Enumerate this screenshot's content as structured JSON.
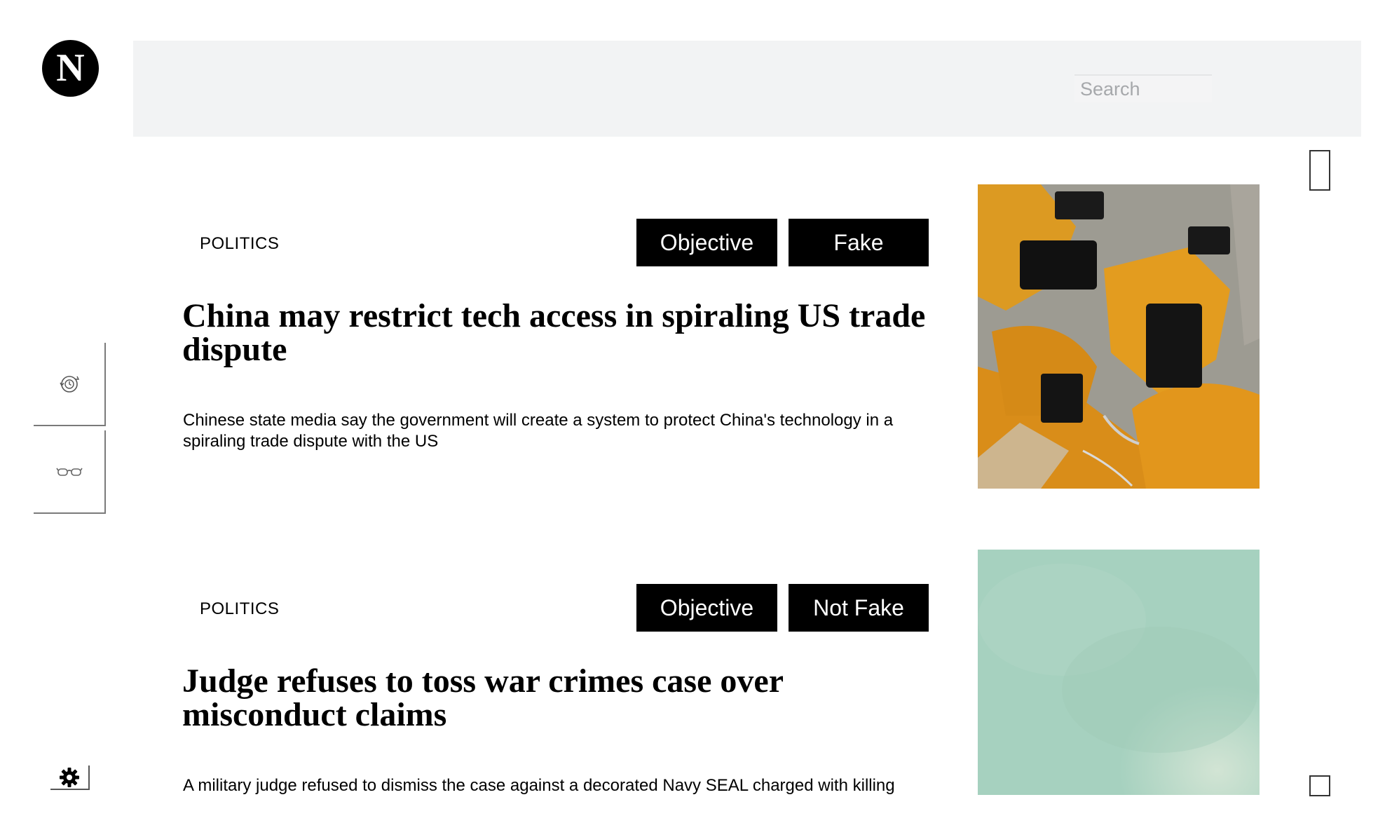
{
  "logo": {
    "letter": "N"
  },
  "header": {
    "search_placeholder": "Search"
  },
  "sidebar": {
    "icons": [
      "history-icon",
      "glasses-icon",
      "gear-icon"
    ]
  },
  "articles": [
    {
      "category": "POLITICS",
      "tags": [
        "Objective",
        "Fake"
      ],
      "headline": "China may restrict tech access in spiraling US trade dispute",
      "summary": "Chinese state media say the government will create a system to protect China's technology in a spiraling trade dispute with the US",
      "image": "industrial-robot-arms-photo"
    },
    {
      "category": "POLITICS",
      "tags": [
        "Objective",
        "Not Fake"
      ],
      "headline": "Judge refuses to toss war crimes case over misconduct claims",
      "summary": "A military judge refused to dismiss the case against a decorated Navy SEAL charged with killing",
      "image": "pale-green-photo"
    }
  ],
  "colors": {
    "header_bg": "#f2f3f4",
    "tag_bg": "#000000",
    "tag_text": "#ffffff",
    "robot_orange": "#e3951d",
    "thumb_green": "#a9d3c0"
  }
}
